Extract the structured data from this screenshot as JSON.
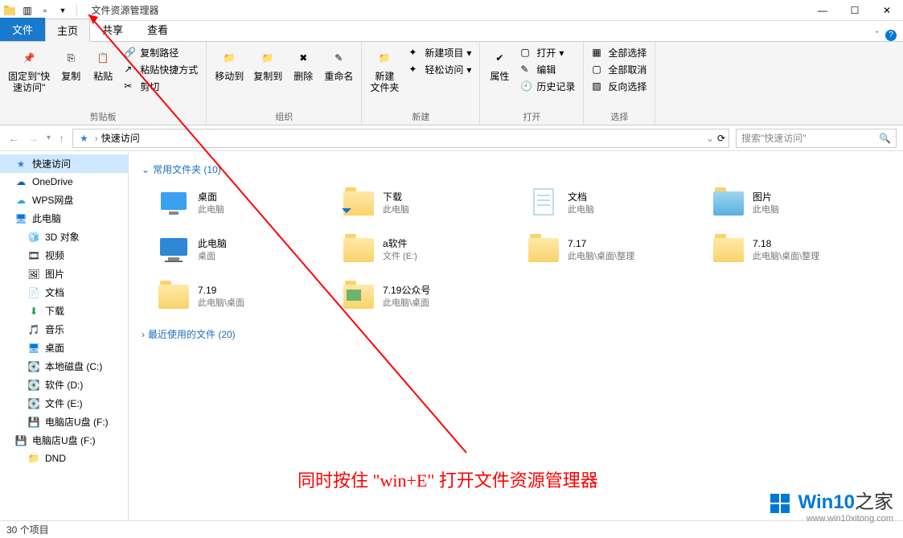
{
  "title": "文件资源管理器",
  "win_controls": {
    "min": "—",
    "max": "☐",
    "close": "✕"
  },
  "tabs": {
    "file": "文件",
    "home": "主页",
    "share": "共享",
    "view": "查看"
  },
  "ribbon": {
    "pin": "固定到\"快\n速访问\"",
    "copy": "复制",
    "paste": "粘贴",
    "copy_path": "复制路径",
    "paste_shortcut": "粘贴快捷方式",
    "cut": "剪切",
    "clip_label": "剪贴板",
    "move_to": "移动到",
    "copy_to": "复制到",
    "delete": "删除",
    "rename": "重命名",
    "org_label": "组织",
    "new_folder": "新建\n文件夹",
    "new_item": "新建项目",
    "easy_access": "轻松访问",
    "new_label": "新建",
    "properties": "属性",
    "open": "打开",
    "edit": "编辑",
    "history": "历史记录",
    "open_label": "打开",
    "select_all": "全部选择",
    "select_none": "全部取消",
    "invert": "反向选择",
    "select_label": "选择"
  },
  "addr": {
    "crumb": "快速访问",
    "refresh": "⟳",
    "search_placeholder": "搜索\"快速访问\""
  },
  "sidebar": {
    "quick": "快速访问",
    "onedrive": "OneDrive",
    "wps": "WPS网盘",
    "pc": "此电脑",
    "obj3d": "3D 对象",
    "video": "视频",
    "pictures": "图片",
    "docs": "文档",
    "downloads": "下载",
    "music": "音乐",
    "desktop": "桌面",
    "disk_c": "本地磁盘 (C:)",
    "disk_d": "软件 (D:)",
    "disk_e": "文件 (E:)",
    "usb1": "电脑店U盘 (F:)",
    "usb2": "电脑店U盘 (F:)",
    "dnd": "DND"
  },
  "content": {
    "group1": "常用文件夹 (10)",
    "group2": "最近使用的文件 (20)",
    "items": [
      {
        "name": "桌面",
        "sub": "此电脑",
        "icon": "desktop"
      },
      {
        "name": "下载",
        "sub": "此电脑",
        "icon": "download"
      },
      {
        "name": "文档",
        "sub": "此电脑",
        "icon": "doc"
      },
      {
        "name": "图片",
        "sub": "此电脑",
        "icon": "picture"
      },
      {
        "name": "此电脑",
        "sub": "桌面",
        "icon": "pc"
      },
      {
        "name": "a软件",
        "sub": "文件 (E:)",
        "icon": "folder"
      },
      {
        "name": "7.17",
        "sub": "此电脑\\桌面\\整理",
        "icon": "folder"
      },
      {
        "name": "7.18",
        "sub": "此电脑\\桌面\\整理",
        "icon": "folder"
      },
      {
        "name": "7.19",
        "sub": "此电脑\\桌面",
        "icon": "folder"
      },
      {
        "name": "7.19公众号",
        "sub": "此电脑\\桌面",
        "icon": "folder-img"
      }
    ]
  },
  "status": "30 个项目",
  "annotation": "同时按住 \"win+E\" 打开文件资源管理器",
  "watermark": {
    "brand": "Win10",
    "suffix": "之家",
    "url": "www.win10xitong.com"
  }
}
